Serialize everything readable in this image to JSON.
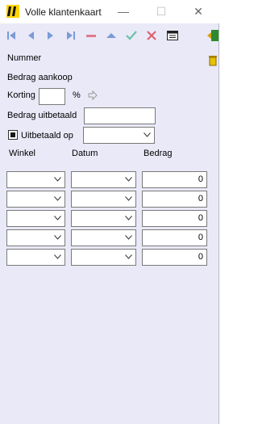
{
  "window": {
    "title": "Volle klantenkaart",
    "minimize_icon": "—",
    "maximize_icon": "☐",
    "close_icon": "✕"
  },
  "form": {
    "nummer_label": "Nummer",
    "bedrag_aankoop_label": "Bedrag aankoop",
    "korting_label": "Korting",
    "korting_unit": "%",
    "korting_value": "",
    "bedrag_uitbetaald_label": "Bedrag uitbetaald",
    "bedrag_uitbetaald_value": "",
    "uitbetaald_op_label": "Uitbetaald op",
    "uitbetaald_op_value": ""
  },
  "grid": {
    "headers": [
      "Winkel",
      "Datum",
      "Bedrag"
    ],
    "rows": [
      {
        "winkel": "",
        "datum": "",
        "bedrag": "0"
      },
      {
        "winkel": "",
        "datum": "",
        "bedrag": "0"
      },
      {
        "winkel": "",
        "datum": "",
        "bedrag": "0"
      },
      {
        "winkel": "",
        "datum": "",
        "bedrag": "0"
      },
      {
        "winkel": "",
        "datum": "",
        "bedrag": "0"
      }
    ]
  },
  "colors": {
    "background": "#e9e9f8",
    "nav_icon": "#7a9bd6",
    "delete": "#e07a8a",
    "confirm": "#6cc0a8",
    "cancel": "#e06070"
  }
}
